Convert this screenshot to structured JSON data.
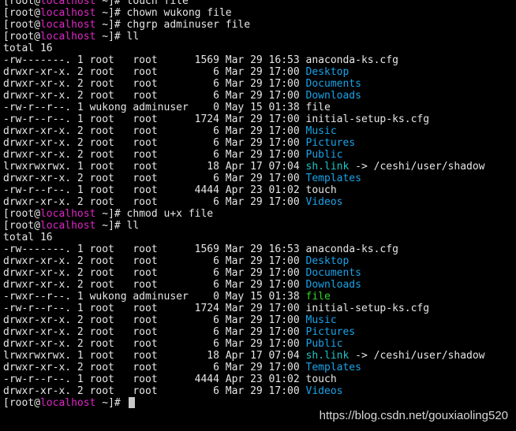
{
  "terminal": {
    "colors": {
      "background": "#000000",
      "foreground": "#e6e6e6",
      "hostname": "#e025c8",
      "directory": "#1aa3e8",
      "symlink": "#1fc4c4",
      "executable": "#2cd82c"
    },
    "lines": [
      [
        {
          "t": "[root@",
          "c": "white"
        },
        {
          "t": "localhost",
          "c": "magenta"
        },
        {
          "t": " ~]# touch file",
          "c": "white"
        }
      ],
      [
        {
          "t": "[root@",
          "c": "white"
        },
        {
          "t": "localhost",
          "c": "magenta"
        },
        {
          "t": " ~]# chown wukong file",
          "c": "white"
        }
      ],
      [
        {
          "t": "[root@",
          "c": "white"
        },
        {
          "t": "localhost",
          "c": "magenta"
        },
        {
          "t": " ~]# chgrp adminuser file",
          "c": "white"
        }
      ],
      [
        {
          "t": "[root@",
          "c": "white"
        },
        {
          "t": "localhost",
          "c": "magenta"
        },
        {
          "t": " ~]# ll",
          "c": "white"
        }
      ],
      [
        {
          "t": "total 16",
          "c": "white"
        }
      ],
      [
        {
          "t": "-rw-------. 1 root   root      1569 Mar 29 16:53 ",
          "c": "white"
        },
        {
          "t": "anaconda-ks.cfg",
          "c": "white"
        }
      ],
      [
        {
          "t": "drwxr-xr-x. 2 root   root         6 Mar 29 17:00 ",
          "c": "white"
        },
        {
          "t": "Desktop",
          "c": "blue"
        }
      ],
      [
        {
          "t": "drwxr-xr-x. 2 root   root         6 Mar 29 17:00 ",
          "c": "white"
        },
        {
          "t": "Documents",
          "c": "blue"
        }
      ],
      [
        {
          "t": "drwxr-xr-x. 2 root   root         6 Mar 29 17:00 ",
          "c": "white"
        },
        {
          "t": "Downloads",
          "c": "blue"
        }
      ],
      [
        {
          "t": "-rw-r--r--. 1 wukong adminuser    0 May 15 01:38 ",
          "c": "white"
        },
        {
          "t": "file",
          "c": "white"
        }
      ],
      [
        {
          "t": "-rw-r--r--. 1 root   root      1724 Mar 29 17:00 ",
          "c": "white"
        },
        {
          "t": "initial-setup-ks.cfg",
          "c": "white"
        }
      ],
      [
        {
          "t": "drwxr-xr-x. 2 root   root         6 Mar 29 17:00 ",
          "c": "white"
        },
        {
          "t": "Music",
          "c": "blue"
        }
      ],
      [
        {
          "t": "drwxr-xr-x. 2 root   root         6 Mar 29 17:00 ",
          "c": "white"
        },
        {
          "t": "Pictures",
          "c": "blue"
        }
      ],
      [
        {
          "t": "drwxr-xr-x. 2 root   root         6 Mar 29 17:00 ",
          "c": "white"
        },
        {
          "t": "Public",
          "c": "blue"
        }
      ],
      [
        {
          "t": "lrwxrwxrwx. 1 root   root        18 Apr 17 07:04 ",
          "c": "white"
        },
        {
          "t": "sh.link",
          "c": "cyan"
        },
        {
          "t": " -> /ceshi/user/shadow",
          "c": "white"
        }
      ],
      [
        {
          "t": "drwxr-xr-x. 2 root   root         6 Mar 29 17:00 ",
          "c": "white"
        },
        {
          "t": "Templates",
          "c": "blue"
        }
      ],
      [
        {
          "t": "-rw-r--r--. 1 root   root      4444 Apr 23 01:02 ",
          "c": "white"
        },
        {
          "t": "touch",
          "c": "white"
        }
      ],
      [
        {
          "t": "drwxr-xr-x. 2 root   root         6 Mar 29 17:00 ",
          "c": "white"
        },
        {
          "t": "Videos",
          "c": "blue"
        }
      ],
      [
        {
          "t": "[root@",
          "c": "white"
        },
        {
          "t": "localhost",
          "c": "magenta"
        },
        {
          "t": " ~]# chmod u+x file",
          "c": "white"
        }
      ],
      [
        {
          "t": "[root@",
          "c": "white"
        },
        {
          "t": "localhost",
          "c": "magenta"
        },
        {
          "t": " ~]# ll",
          "c": "white"
        }
      ],
      [
        {
          "t": "total 16",
          "c": "white"
        }
      ],
      [
        {
          "t": "-rw-------. 1 root   root      1569 Mar 29 16:53 ",
          "c": "white"
        },
        {
          "t": "anaconda-ks.cfg",
          "c": "white"
        }
      ],
      [
        {
          "t": "drwxr-xr-x. 2 root   root         6 Mar 29 17:00 ",
          "c": "white"
        },
        {
          "t": "Desktop",
          "c": "blue"
        }
      ],
      [
        {
          "t": "drwxr-xr-x. 2 root   root         6 Mar 29 17:00 ",
          "c": "white"
        },
        {
          "t": "Documents",
          "c": "blue"
        }
      ],
      [
        {
          "t": "drwxr-xr-x. 2 root   root         6 Mar 29 17:00 ",
          "c": "white"
        },
        {
          "t": "Downloads",
          "c": "blue"
        }
      ],
      [
        {
          "t": "-rwxr--r--. 1 wukong adminuser    0 May 15 01:38 ",
          "c": "white"
        },
        {
          "t": "file",
          "c": "green"
        }
      ],
      [
        {
          "t": "-rw-r--r--. 1 root   root      1724 Mar 29 17:00 ",
          "c": "white"
        },
        {
          "t": "initial-setup-ks.cfg",
          "c": "white"
        }
      ],
      [
        {
          "t": "drwxr-xr-x. 2 root   root         6 Mar 29 17:00 ",
          "c": "white"
        },
        {
          "t": "Music",
          "c": "blue"
        }
      ],
      [
        {
          "t": "drwxr-xr-x. 2 root   root         6 Mar 29 17:00 ",
          "c": "white"
        },
        {
          "t": "Pictures",
          "c": "blue"
        }
      ],
      [
        {
          "t": "drwxr-xr-x. 2 root   root         6 Mar 29 17:00 ",
          "c": "white"
        },
        {
          "t": "Public",
          "c": "blue"
        }
      ],
      [
        {
          "t": "lrwxrwxrwx. 1 root   root        18 Apr 17 07:04 ",
          "c": "white"
        },
        {
          "t": "sh.link",
          "c": "cyan"
        },
        {
          "t": " -> /ceshi/user/shadow",
          "c": "white"
        }
      ],
      [
        {
          "t": "drwxr-xr-x. 2 root   root         6 Mar 29 17:00 ",
          "c": "white"
        },
        {
          "t": "Templates",
          "c": "blue"
        }
      ],
      [
        {
          "t": "-rw-r--r--. 1 root   root      4444 Apr 23 01:02 ",
          "c": "white"
        },
        {
          "t": "touch",
          "c": "white"
        }
      ],
      [
        {
          "t": "drwxr-xr-x. 2 root   root         6 Mar 29 17:00 ",
          "c": "white"
        },
        {
          "t": "Videos",
          "c": "blue"
        }
      ]
    ],
    "current_prompt": {
      "prefix": "[root@",
      "host": "localhost",
      "suffix": " ~]# "
    }
  },
  "watermark": "https://blog.csdn.net/gouxiaoling520"
}
